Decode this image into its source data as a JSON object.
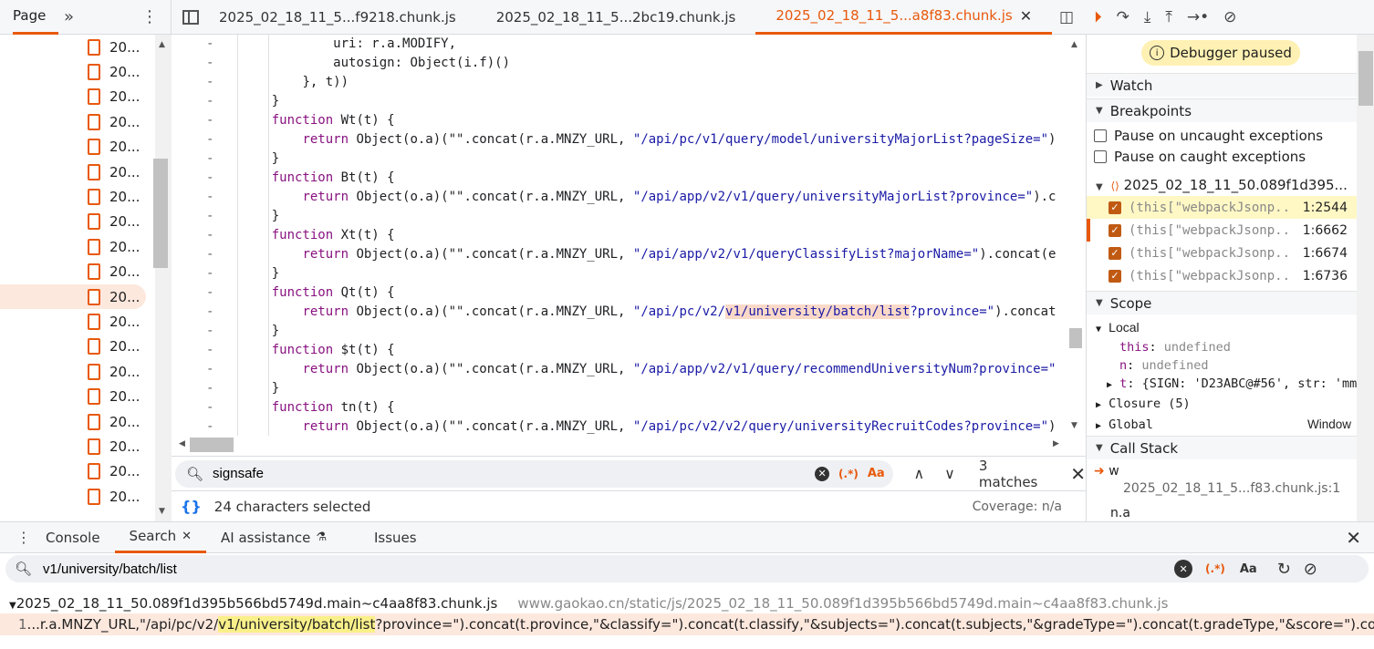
{
  "left_panel": {
    "tab_label": "Page",
    "files": [
      "20...",
      "20...",
      "20...",
      "20...",
      "20...",
      "20...",
      "20...",
      "20...",
      "20...",
      "20...",
      "20...",
      "20...",
      "20...",
      "20...",
      "20...",
      "20...",
      "20...",
      "20...",
      "20..."
    ],
    "selected_index": 10
  },
  "editor": {
    "tabs": [
      {
        "label": "2025_02_18_11_5...f9218.chunk.js",
        "active": false
      },
      {
        "label": "2025_02_18_11_5...2bc19.chunk.js",
        "active": false
      },
      {
        "label": "2025_02_18_11_5...a8f83.chunk.js",
        "active": true
      }
    ],
    "gutter_mark": "-",
    "code_lines": [
      {
        "indent": "            ",
        "parts": [
          {
            "t": "uri: r.a.MODIFY,",
            "c": ""
          }
        ]
      },
      {
        "indent": "            ",
        "parts": [
          {
            "t": "autosign: Object(i.f)()",
            "c": ""
          }
        ]
      },
      {
        "indent": "        ",
        "parts": [
          {
            "t": "}, t))",
            "c": ""
          }
        ]
      },
      {
        "indent": "    ",
        "parts": [
          {
            "t": "}",
            "c": ""
          }
        ]
      },
      {
        "indent": "    ",
        "parts": [
          {
            "t": "function",
            "c": "kw"
          },
          {
            "t": " Wt(t) {",
            "c": ""
          }
        ]
      },
      {
        "indent": "        ",
        "parts": [
          {
            "t": "return",
            "c": "kw"
          },
          {
            "t": " Object(o.a)(\"\".concat(r.a.MNZY_URL, ",
            "c": ""
          },
          {
            "t": "\"/api/pc/v1/query/model/universityMajorList?pageSize=\"",
            "c": "str"
          },
          {
            "t": ")",
            "c": ""
          }
        ]
      },
      {
        "indent": "    ",
        "parts": [
          {
            "t": "}",
            "c": ""
          }
        ]
      },
      {
        "indent": "    ",
        "parts": [
          {
            "t": "function",
            "c": "kw"
          },
          {
            "t": " Bt(t) {",
            "c": ""
          }
        ]
      },
      {
        "indent": "        ",
        "parts": [
          {
            "t": "return",
            "c": "kw"
          },
          {
            "t": " Object(o.a)(\"\".concat(r.a.MNZY_URL, ",
            "c": ""
          },
          {
            "t": "\"/api/app/v2/v1/query/universityMajorList?province=\"",
            "c": "str"
          },
          {
            "t": ").c",
            "c": ""
          }
        ]
      },
      {
        "indent": "    ",
        "parts": [
          {
            "t": "}",
            "c": ""
          }
        ]
      },
      {
        "indent": "    ",
        "parts": [
          {
            "t": "function",
            "c": "kw"
          },
          {
            "t": " Xt(t) {",
            "c": ""
          }
        ]
      },
      {
        "indent": "        ",
        "parts": [
          {
            "t": "return",
            "c": "kw"
          },
          {
            "t": " Object(o.a)(\"\".concat(r.a.MNZY_URL, ",
            "c": ""
          },
          {
            "t": "\"/api/app/v2/v1/queryClassifyList?majorName=\"",
            "c": "str"
          },
          {
            "t": ").concat(e",
            "c": ""
          }
        ]
      },
      {
        "indent": "    ",
        "parts": [
          {
            "t": "}",
            "c": ""
          }
        ]
      },
      {
        "indent": "    ",
        "parts": [
          {
            "t": "function",
            "c": "kw"
          },
          {
            "t": " Qt(t) {",
            "c": ""
          }
        ]
      },
      {
        "indent": "        ",
        "parts": [
          {
            "t": "return",
            "c": "kw"
          },
          {
            "t": " Object(o.a)(\"\".concat(r.a.MNZY_URL, ",
            "c": ""
          },
          {
            "t": "\"/api/pc/v2/",
            "c": "str"
          },
          {
            "t": "v1/university/batch/list",
            "c": "str hl"
          },
          {
            "t": "?province=\"",
            "c": "str"
          },
          {
            "t": ").concat",
            "c": ""
          }
        ]
      },
      {
        "indent": "    ",
        "parts": [
          {
            "t": "}",
            "c": ""
          }
        ]
      },
      {
        "indent": "    ",
        "parts": [
          {
            "t": "function",
            "c": "kw"
          },
          {
            "t": " $t(t) {",
            "c": ""
          }
        ]
      },
      {
        "indent": "        ",
        "parts": [
          {
            "t": "return",
            "c": "kw"
          },
          {
            "t": " Object(o.a)(\"\".concat(r.a.MNZY_URL, ",
            "c": ""
          },
          {
            "t": "\"/api/app/v2/v1/query/recommendUniversityNum?province=\"",
            "c": "str"
          }
        ]
      },
      {
        "indent": "    ",
        "parts": [
          {
            "t": "}",
            "c": ""
          }
        ]
      },
      {
        "indent": "    ",
        "parts": [
          {
            "t": "function",
            "c": "kw"
          },
          {
            "t": " tn(t) {",
            "c": ""
          }
        ]
      },
      {
        "indent": "        ",
        "parts": [
          {
            "t": "return",
            "c": "kw"
          },
          {
            "t": " Object(o.a)(\"\".concat(r.a.MNZY_URL, ",
            "c": ""
          },
          {
            "t": "\"/api/pc/v2/v2/query/universityRecruitCodes?province=\"",
            "c": "str"
          },
          {
            "t": ")",
            "c": ""
          }
        ]
      }
    ],
    "find": {
      "query": "signsafe",
      "regex_label": "(.*)",
      "case_label": "Aa",
      "matches": "3 matches"
    },
    "status": {
      "brace_icon": "{}",
      "selection": "24 characters selected",
      "coverage": "Coverage: n/a"
    }
  },
  "debugger": {
    "paused_label": "Debugger paused",
    "sections": {
      "watch": "Watch",
      "breakpoints": "Breakpoints",
      "scope": "Scope",
      "call_stack": "Call Stack"
    },
    "pause_uncaught": "Pause on uncaught exceptions",
    "pause_caught": "Pause on caught exceptions",
    "bp_file": "2025_02_18_11_50.089f1d395...",
    "breakpoints": [
      {
        "code": "(this[\"webpackJsonp...",
        "line": "1:2544",
        "current": true
      },
      {
        "code": "(this[\"webpackJsonp...",
        "line": "1:6662",
        "current": false
      },
      {
        "code": "(this[\"webpackJsonp...",
        "line": "1:6674",
        "current": false
      },
      {
        "code": "(this[\"webpackJsonp...",
        "line": "1:6736",
        "current": false
      }
    ],
    "scope": {
      "local_label": "Local",
      "this_key": "this",
      "this_val": "undefined",
      "n_key": "n",
      "n_val": "undefined",
      "t_key": "t",
      "t_val": "{SIGN: 'D23ABC@#56', str: 'mm",
      "closure_label": "Closure (5)",
      "global_label": "Global",
      "global_val": "Window"
    },
    "call_stack": [
      {
        "fn": "w",
        "loc": "2025_02_18_11_5...f83.chunk.js:1"
      },
      {
        "fn": "n.a",
        "loc": ""
      }
    ]
  },
  "drawer": {
    "tabs": [
      {
        "label": "Console",
        "active": false
      },
      {
        "label": "Search",
        "active": true
      },
      {
        "label": "AI assistance",
        "active": false
      },
      {
        "label": "Issues",
        "active": false
      }
    ],
    "search_query": "v1/university/batch/list",
    "regex_label": "(.*)",
    "case_label": "Aa",
    "result_file": "2025_02_18_11_50.089f1d395b566bd5749d.main~c4aa8f83.chunk.js",
    "result_url": "www.gaokao.cn/static/js/2025_02_18_11_50.089f1d395b566bd5749d.main~c4aa8f83.chunk.js",
    "result_line_num": "1",
    "result_pre": "...r.a.MNZY_URL,\"/api/pc/v2/",
    "result_match": "v1/university/batch/list",
    "result_post": "?province=\").concat(t.province,\"&classify=\").concat(t.classify,\"&subjects=\").concat(t.subjects,\"&gradeType=\").concat(t.gradeType,\"&score=\").concat(t.s..."
  }
}
